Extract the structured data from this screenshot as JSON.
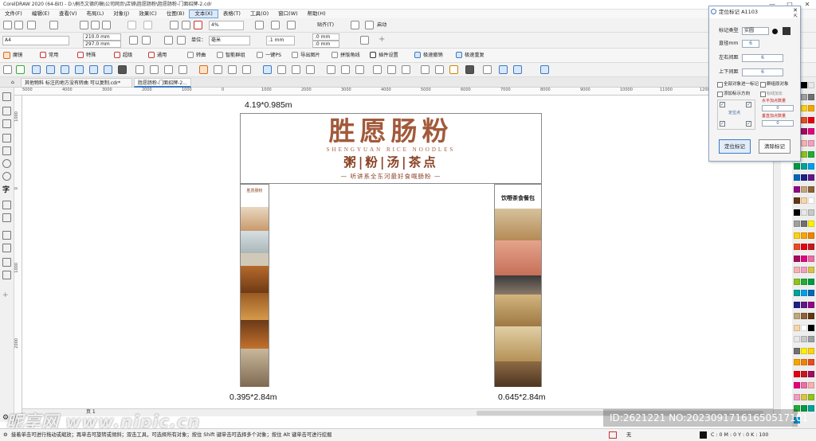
{
  "window": {
    "title": "CorelDRAW 2020 (64-Bit) - D:\\桐杰文德的稿\\公司网页\\店铺\\胜愿肠粉\\胜愿肠粉-门面招牌-2.cdr",
    "controls": [
      "—",
      "□",
      "✕"
    ]
  },
  "menu": {
    "items": [
      "文件(F)",
      "编辑(E)",
      "查看(V)",
      "布局(L)",
      "对象(J)",
      "效果(C)",
      "位图(B)",
      "文本(X)",
      "表格(T)",
      "工具(O)",
      "窗口(W)",
      "帮助(H)"
    ],
    "active_index": 7
  },
  "toolbar1": {
    "zoom": "4%",
    "snap_label": "贴齐(T)",
    "launch_label": "启动"
  },
  "toolbar2": {
    "page_size": "A4",
    "width": "210.0 mm",
    "height": "297.0 mm",
    "unit_label": "单位：",
    "unit_value": "毫米",
    "nudge": ".1 mm",
    "dup_x": ".0 mm",
    "dup_y": ".0 mm"
  },
  "toolbar3": {
    "items": [
      "魔镜",
      "常用",
      "特殊",
      "超级",
      "通用",
      "转曲",
      "智能群组",
      "一键PS",
      "导出图片",
      "拼版角线",
      "插件设置",
      "极速撤销",
      "极速重复"
    ]
  },
  "tabs": [
    {
      "label": "胜愿肠粉-门面招牌-2.cdr"
    },
    {
      "label": "其他物料  标注的地方没有转曲 可以复制.cdr*"
    },
    {
      "label": "胜愿肠粉-门面招牌-2..."
    }
  ],
  "ruler": {
    "h_ticks": [
      "5000",
      "4000",
      "3000",
      "2000",
      "1000",
      "0",
      "1000",
      "2000",
      "3000",
      "4000",
      "5000",
      "6000",
      "7000",
      "8000",
      "9000",
      "10000",
      "11000",
      "12000"
    ],
    "v_ticks": [
      "1000",
      "0",
      "1000",
      "2000",
      "3000"
    ]
  },
  "artwork": {
    "arch_dimension": "4.19*0.985m",
    "left_dimension": "0.395*2.84m",
    "right_dimension": "0.645*2.84m",
    "brand": "胜愿肠粉",
    "pinyin": "SHENGYUAN RICE NOODLES",
    "subtitle": "粥|粉|汤|茶点",
    "slogan": "— 听讲系全东河最好食嘅肠粉 —",
    "left_pillar_top": "胜愿肠粉",
    "right_pillar_top": "饮嘢茶食餐包"
  },
  "page_nav": {
    "label": "页 1"
  },
  "dialog": {
    "title": "定位标记 A1103",
    "close": "✕",
    "pin": "⇱",
    "mark_type_label": "标记类型",
    "mark_type_value": "实圆",
    "diameter_label": "直径mm",
    "diameter_value": "6",
    "lr_label": "左右间距",
    "lr_value": "6",
    "tb_label": "上下间距",
    "tb_value": "6",
    "opt_all": "全部对象进一标记",
    "opt_group": "群组原对象",
    "opt_orient": "添加标示方向",
    "opt_add": "标线加长",
    "pos_point": "定位点",
    "horiz_label": "水平加点数量",
    "horiz_value": "0",
    "vert_label": "垂直加点数量",
    "vert_value": "0",
    "btn_apply": "定位标记",
    "btn_clear": "清除标记"
  },
  "status": {
    "hint": "接着单击可进行拖动或缩放；再单击可旋转或倾斜；双击工具，可选择所有对象；按住 Shift 键单击可选择多个对象；按住 Alt 键单击可进行挖掘",
    "fill": "无",
    "color_model": "C : 0 M : 0 Y : 0 K : 100"
  },
  "watermark": {
    "left": "昵享网 www.nipic.cn",
    "right": "ID:2621221 NO:20230917161650517101"
  },
  "colors": {
    "brand_text": "#a25a3b",
    "sub_text": "#8a4326",
    "accent": "#3d7ac4"
  }
}
